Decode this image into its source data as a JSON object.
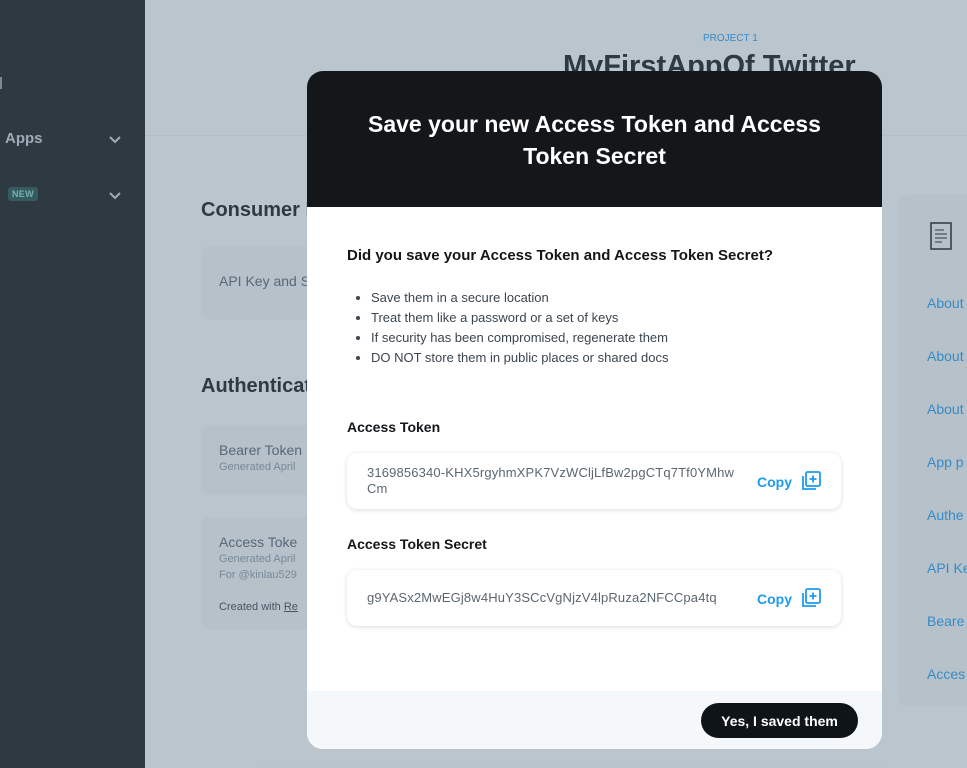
{
  "sidebar": {
    "items": [
      {
        "label": "Apps"
      },
      {
        "badge": "NEW"
      }
    ]
  },
  "header": {
    "kicker": "PROJECT 1",
    "title": "MyFirstAppOf Twitter"
  },
  "background": {
    "consumer_title": "Consumer K",
    "api_key_label": "API Key and S",
    "auth_title": "Authenticati",
    "bearer_label": "Bearer Token",
    "bearer_sub": "Generated April",
    "access_label": "Access Toke",
    "access_sub1": "Generated April",
    "access_sub2": "For @kinlau529",
    "created_with": "Created with",
    "created_link": "Re"
  },
  "right_panel": {
    "links": [
      "About",
      "About",
      "About",
      "App p",
      "Authe",
      "API Ke",
      "Beare",
      "Acces"
    ]
  },
  "modal": {
    "title": "Save your new Access Token and Access Token Secret",
    "question": "Did you save your Access Token and Access Token Secret?",
    "bullets": [
      "Save them in a secure location",
      "Treat them like a password or a set of keys",
      "If security has been compromised, regenerate them",
      "DO NOT store them in public places or shared docs"
    ],
    "access_token_label": "Access Token",
    "access_token_value": "3169856340-KHX5rgyhmXPK7VzWCljLfBw2pgCTq7Tf0YMhwCm",
    "access_secret_label": "Access Token Secret",
    "access_secret_value": "g9YASx2MwEGj8w4HuY3SCcVgNjzV4lpRuza2NFCCpa4tq",
    "copy_label": "Copy",
    "confirm_label": "Yes, I saved them"
  },
  "colors": {
    "accent": "#1d9bf0",
    "dark": "#14171a"
  }
}
